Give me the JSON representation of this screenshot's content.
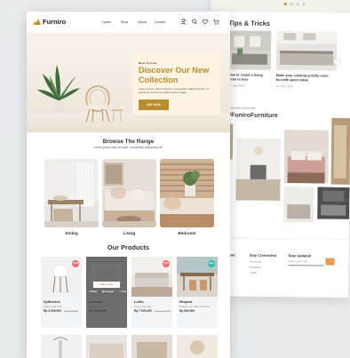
{
  "background_page": {
    "tips_title": "Tips & Tricks",
    "tips": [
      {
        "caption": "How to create a living room to love",
        "date": "01 June 2022"
      },
      {
        "caption": "Make your cooking activity more fun with good setup",
        "date": "01 June 2022"
      }
    ],
    "share_text": "Share your setup with",
    "hashtag": "#FuniroFurniture",
    "footer": {
      "col1": "Account",
      "col2": "Stay Connected",
      "col3": "Stay Updated",
      "links_col2": [
        "Facebook",
        "Instagram",
        "Twitter"
      ],
      "links_col1": [
        "About",
        "Contact",
        "Blog",
        "Privacy"
      ],
      "newsletter_placeholder": "Enter your email"
    }
  },
  "nav": {
    "brand": "Furniro",
    "links": [
      "Home",
      "Shop",
      "About",
      "Contact"
    ],
    "icons": [
      "user-icon",
      "search-icon",
      "heart-icon",
      "cart-icon"
    ]
  },
  "hero": {
    "kicker": "New Arrival",
    "title": "Discover Our New Collection",
    "description": "Lorem ipsum dolor sit amet, consectetur adipiscing elit. Ut elit tellus, luctus nec ullamcorper mattis.",
    "button": "BUY NOW"
  },
  "range": {
    "title": "Browse The Range",
    "subtitle": "Lorem ipsum dolor sit amet, consectetur adipiscing elit.",
    "items": [
      {
        "label": "Dining"
      },
      {
        "label": "Living"
      },
      {
        "label": "Bedroom"
      }
    ]
  },
  "products": {
    "title": "Our Products",
    "items": [
      {
        "name": "Syltherine",
        "desc": "Stylish cafe chair",
        "price": "Rp 2.500.000",
        "old_price": "Rp 3.500.000",
        "badge": "-30%",
        "badge_color": "#e97171"
      },
      {
        "name": "Leviosa",
        "desc": "Stylish cafe chair",
        "price": "Rp 2.500.000",
        "old_price": "",
        "badge": "",
        "badge_color": ""
      },
      {
        "name": "Lolito",
        "desc": "Luxury big sofa",
        "price": "Rp 7.000.000",
        "old_price": "Rp 14.000.000",
        "badge": "-50%",
        "badge_color": "#e97171"
      },
      {
        "name": "Respira",
        "desc": "Outdoor bar table and stool",
        "price": "Rp 500.000",
        "old_price": "",
        "badge": "New",
        "badge_color": "#2ec1ac"
      }
    ],
    "hover": {
      "add_to_cart": "Add to cart",
      "share": "Share",
      "compare": "Compare",
      "like": "Like"
    }
  },
  "colors": {
    "accent": "#b88e2f",
    "hero_card": "#fff3e3",
    "product_card": "#f4f5f7",
    "sale_badge": "#e97171",
    "new_badge": "#2ec1ac"
  }
}
